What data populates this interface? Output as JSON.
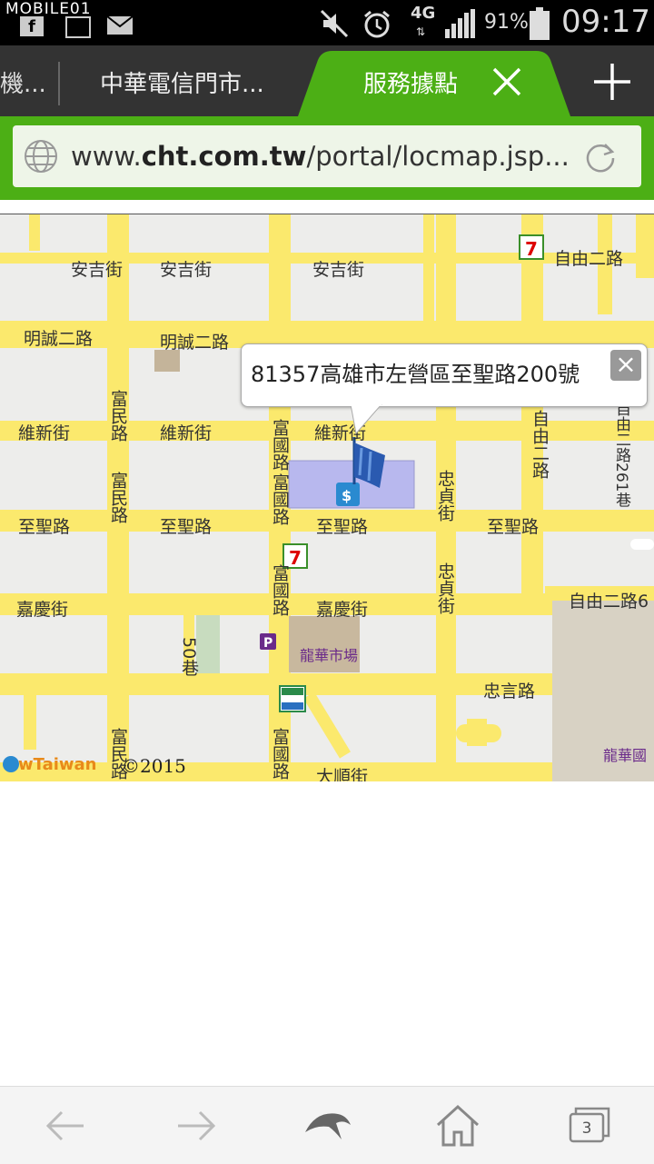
{
  "status_bar": {
    "watermark": "MOBILE01",
    "network": "4G",
    "battery": "91%",
    "time": "09:17"
  },
  "tabs": [
    {
      "label": "機..."
    },
    {
      "label": "中華電信門市..."
    },
    {
      "label": "服務據點"
    }
  ],
  "url": {
    "prefix": "www.",
    "domain": "cht.com.tw",
    "path": "/portal/locmap.jsp..."
  },
  "map": {
    "callout_text": "81357高雄市左營區至聖路200號",
    "copyright": "©2015",
    "provider": "UrMap Taiwan",
    "streets": {
      "anji": "安吉街",
      "mingcheng2": "明誠二路",
      "weixin": "維新街",
      "zhisheng": "至聖路",
      "jiaqing": "嘉慶街",
      "fumin": "富民路",
      "fuguo": "富國路",
      "zhongzhen": "忠貞街",
      "ziyou2": "自由二路",
      "zhongyan": "忠言路",
      "lane50": "50巷",
      "lane261": "自由二路261巷",
      "ziyou26": "自由二路6",
      "dashun": "大順街",
      "longhua_market": "龍華市場",
      "longhua_school": "龍華國"
    },
    "colors": {
      "road": "#fbe96d",
      "bg": "#ededeb",
      "block": "#e6e6e2"
    }
  },
  "bottom_nav": {
    "tab_count": "3"
  }
}
